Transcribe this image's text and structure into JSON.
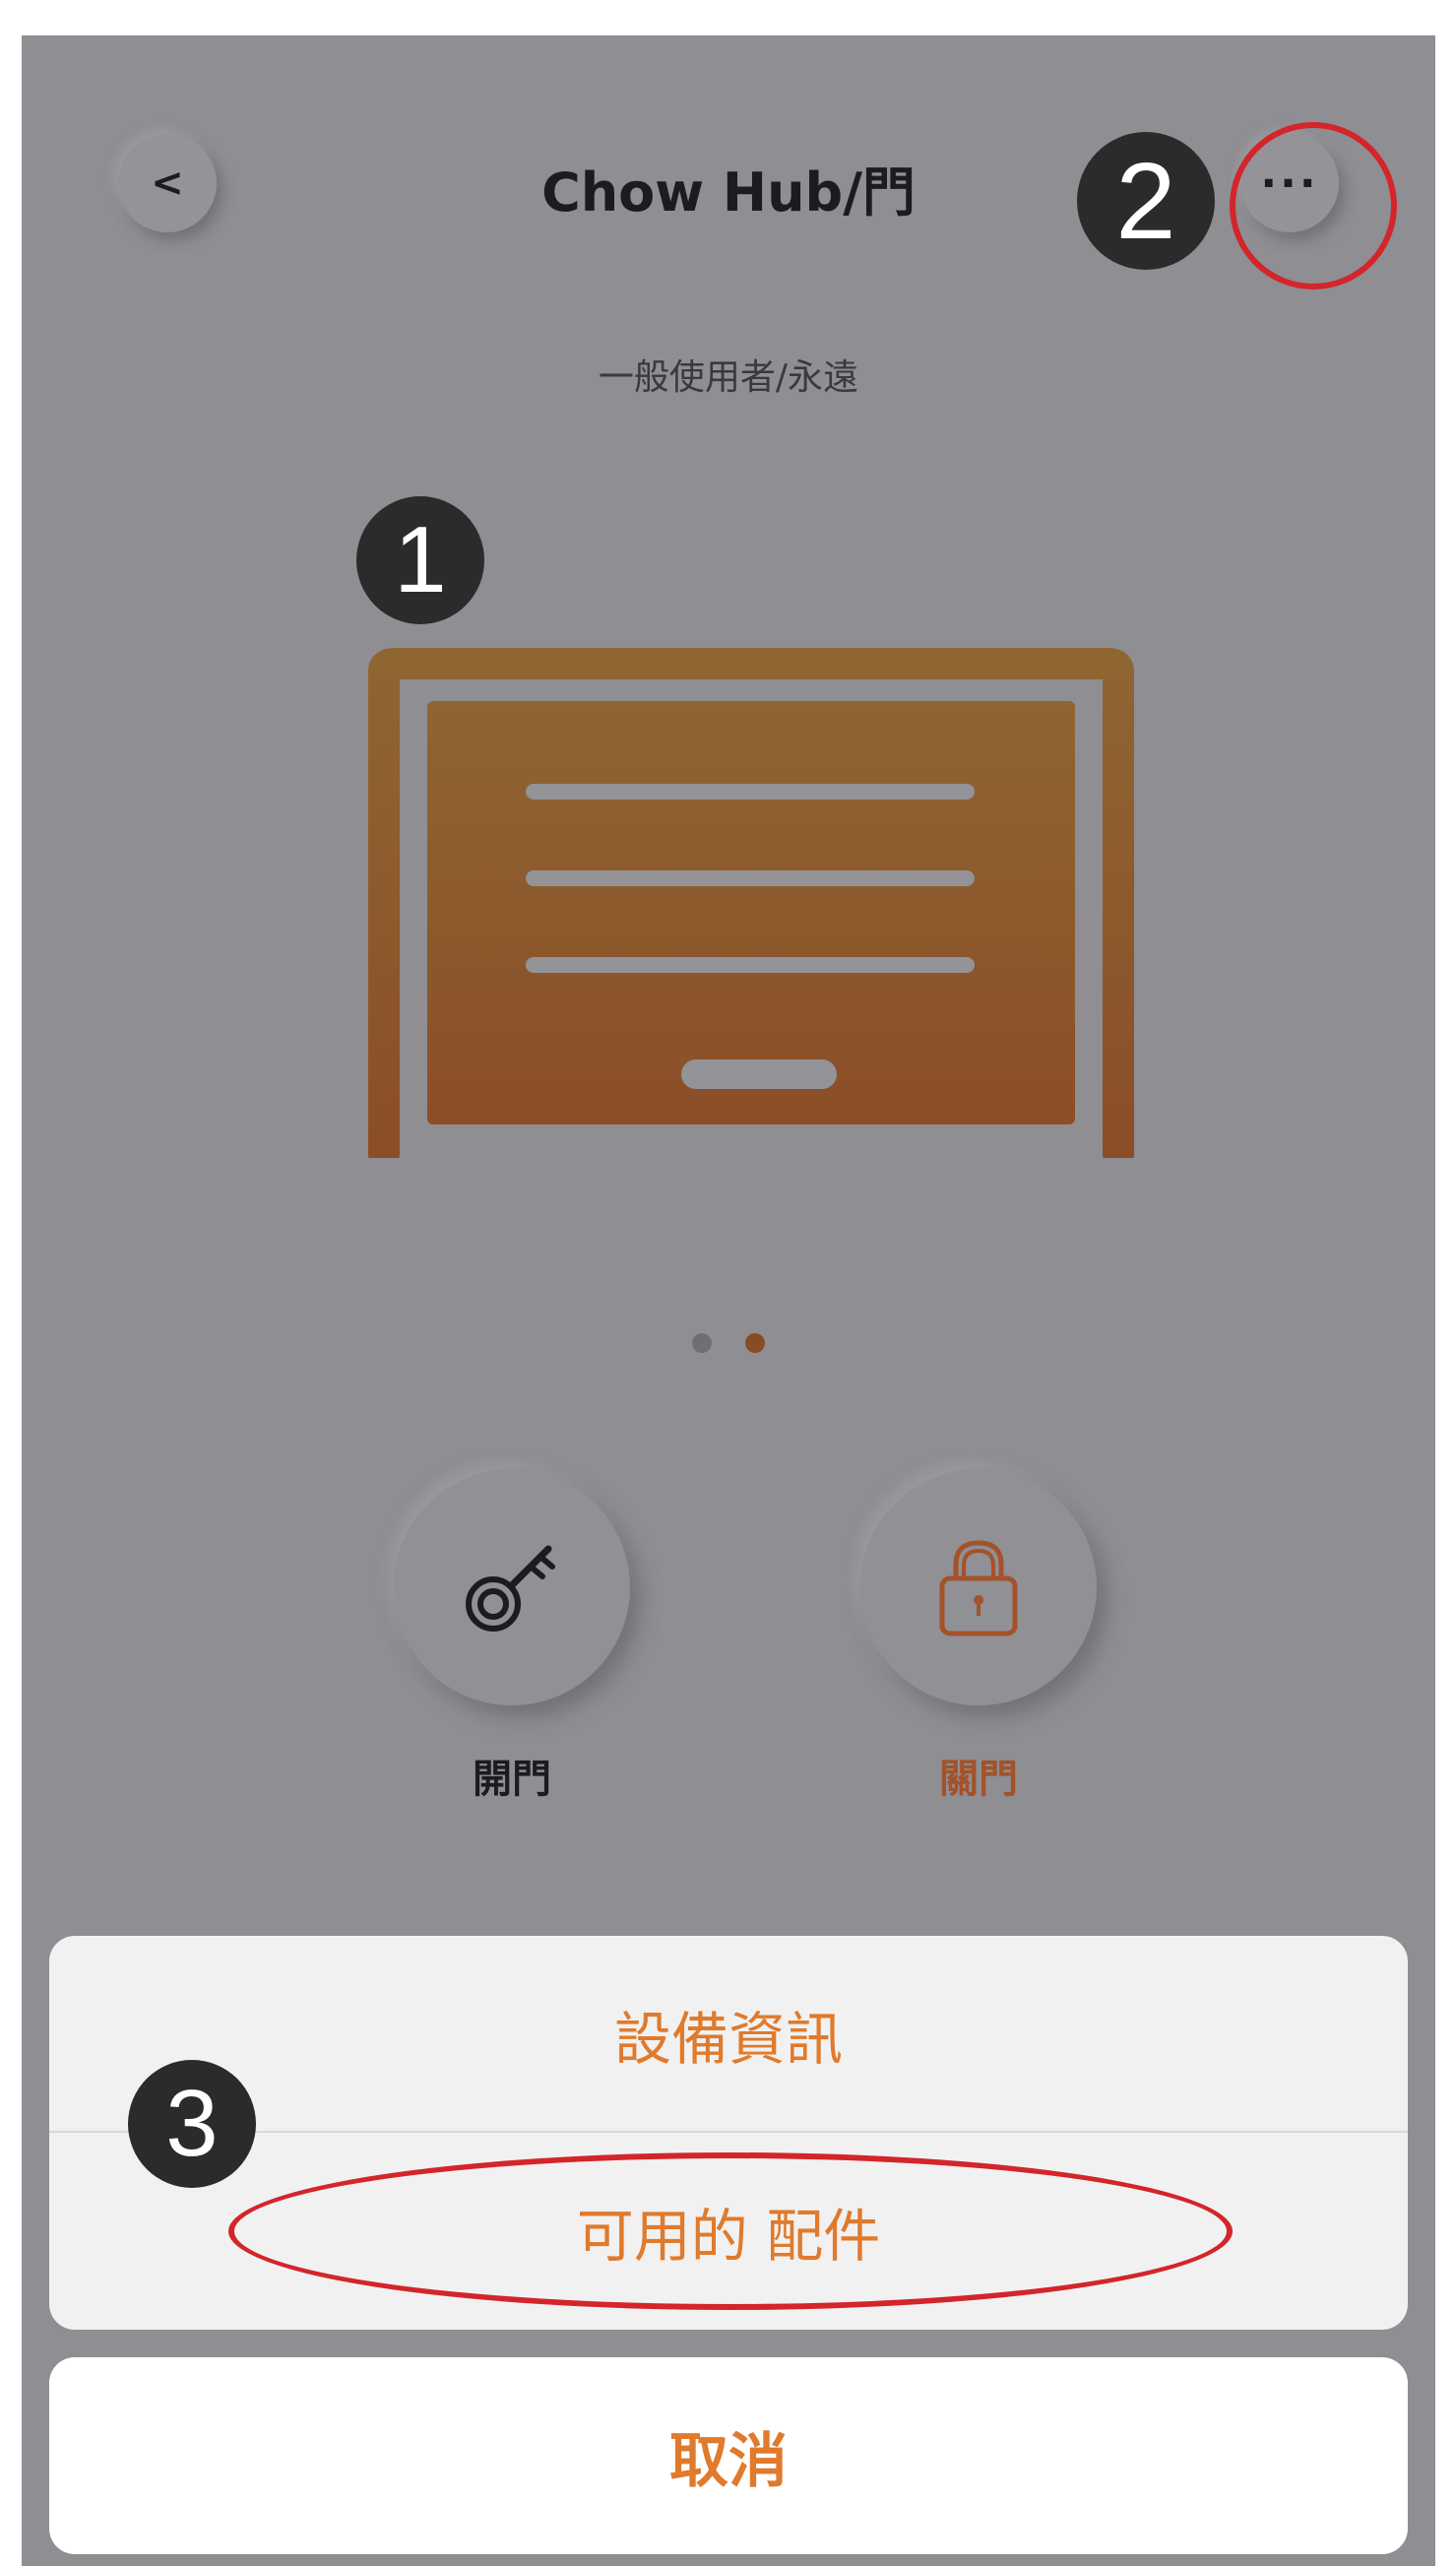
{
  "header": {
    "back_label": "<",
    "title": "Chow Hub/門",
    "more_label": "···",
    "subtitle": "一般使用者/永遠"
  },
  "markers": [
    "1",
    "2",
    "3"
  ],
  "pager": {
    "total": 2,
    "current": 2
  },
  "actions": [
    {
      "label": "開門",
      "icon": "key-icon"
    },
    {
      "label": "關門",
      "icon": "lock-icon"
    }
  ],
  "action_sheet": {
    "items": [
      "設備資訊",
      "可用的 配件"
    ],
    "cancel": "取消"
  },
  "colors": {
    "accent": "#e07a2c",
    "door": "#8a4a23",
    "annotation": "#d3252a",
    "overlay": "#8e8e93"
  }
}
